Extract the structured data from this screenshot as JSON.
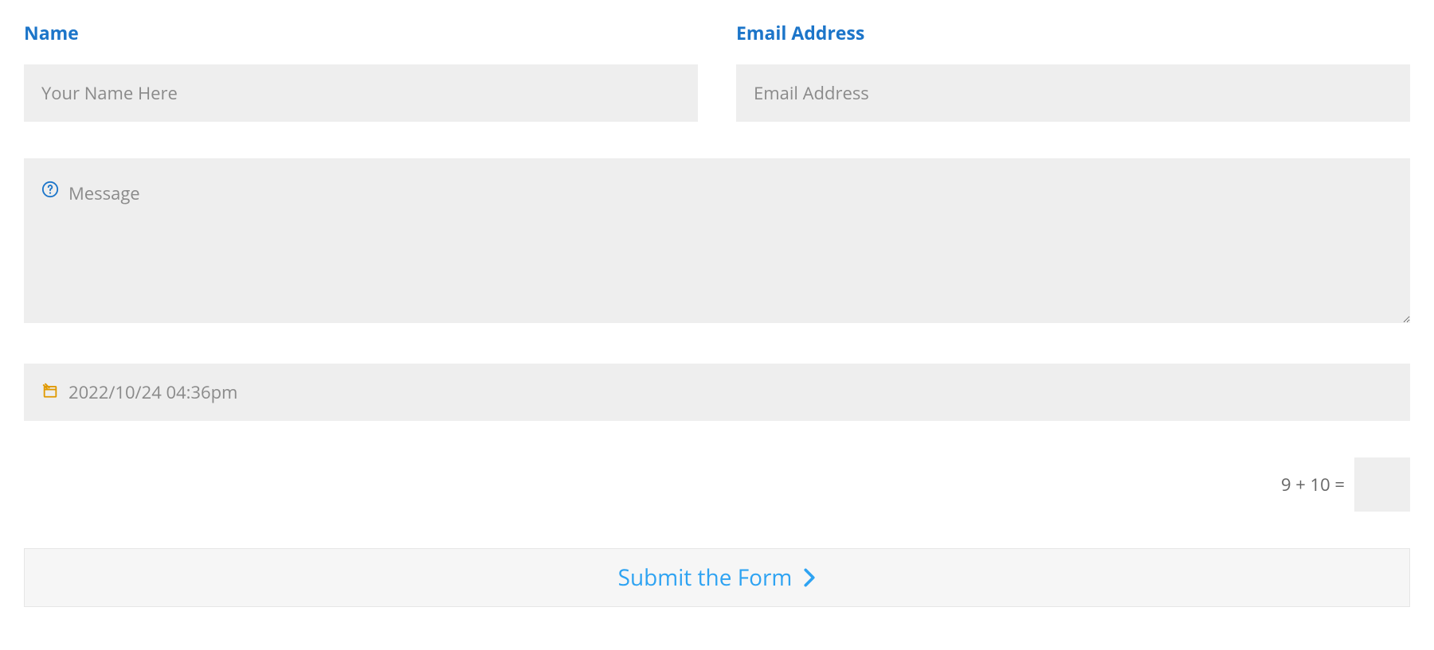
{
  "form": {
    "name": {
      "label": "Name",
      "placeholder": "Your Name Here"
    },
    "email": {
      "label": "Email Address",
      "placeholder": "Email Address"
    },
    "message": {
      "placeholder": "Message"
    },
    "date": {
      "placeholder": "2022/10/24 04:36pm"
    },
    "captcha": {
      "question": "9 + 10 ="
    },
    "submit": {
      "label": "Submit the Form"
    }
  },
  "icons": {
    "help_color": "#1c75c9",
    "date_color": "#e09900",
    "chevron_color": "#2ea3f2"
  }
}
